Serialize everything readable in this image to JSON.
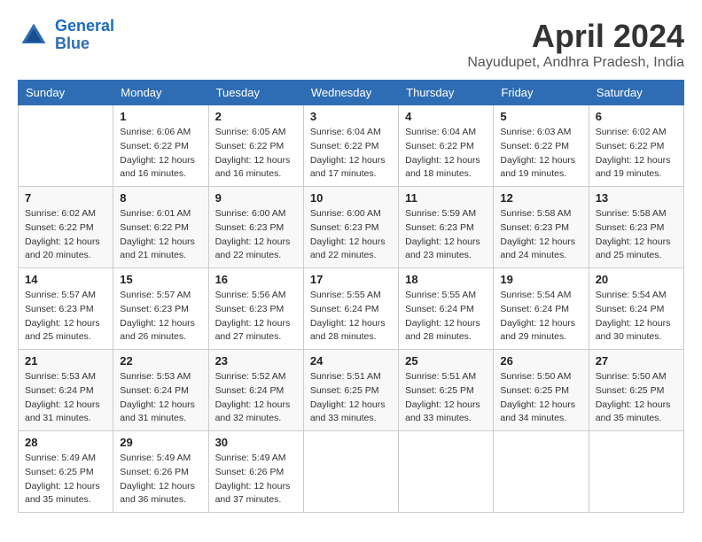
{
  "header": {
    "logo_line1": "General",
    "logo_line2": "Blue",
    "title": "April 2024",
    "location": "Nayudupet, Andhra Pradesh, India"
  },
  "columns": [
    "Sunday",
    "Monday",
    "Tuesday",
    "Wednesday",
    "Thursday",
    "Friday",
    "Saturday"
  ],
  "weeks": [
    [
      {
        "day": "",
        "info": ""
      },
      {
        "day": "1",
        "info": "Sunrise: 6:06 AM\nSunset: 6:22 PM\nDaylight: 12 hours\nand 16 minutes."
      },
      {
        "day": "2",
        "info": "Sunrise: 6:05 AM\nSunset: 6:22 PM\nDaylight: 12 hours\nand 16 minutes."
      },
      {
        "day": "3",
        "info": "Sunrise: 6:04 AM\nSunset: 6:22 PM\nDaylight: 12 hours\nand 17 minutes."
      },
      {
        "day": "4",
        "info": "Sunrise: 6:04 AM\nSunset: 6:22 PM\nDaylight: 12 hours\nand 18 minutes."
      },
      {
        "day": "5",
        "info": "Sunrise: 6:03 AM\nSunset: 6:22 PM\nDaylight: 12 hours\nand 19 minutes."
      },
      {
        "day": "6",
        "info": "Sunrise: 6:02 AM\nSunset: 6:22 PM\nDaylight: 12 hours\nand 19 minutes."
      }
    ],
    [
      {
        "day": "7",
        "info": "Sunrise: 6:02 AM\nSunset: 6:22 PM\nDaylight: 12 hours\nand 20 minutes."
      },
      {
        "day": "8",
        "info": "Sunrise: 6:01 AM\nSunset: 6:22 PM\nDaylight: 12 hours\nand 21 minutes."
      },
      {
        "day": "9",
        "info": "Sunrise: 6:00 AM\nSunset: 6:23 PM\nDaylight: 12 hours\nand 22 minutes."
      },
      {
        "day": "10",
        "info": "Sunrise: 6:00 AM\nSunset: 6:23 PM\nDaylight: 12 hours\nand 22 minutes."
      },
      {
        "day": "11",
        "info": "Sunrise: 5:59 AM\nSunset: 6:23 PM\nDaylight: 12 hours\nand 23 minutes."
      },
      {
        "day": "12",
        "info": "Sunrise: 5:58 AM\nSunset: 6:23 PM\nDaylight: 12 hours\nand 24 minutes."
      },
      {
        "day": "13",
        "info": "Sunrise: 5:58 AM\nSunset: 6:23 PM\nDaylight: 12 hours\nand 25 minutes."
      }
    ],
    [
      {
        "day": "14",
        "info": "Sunrise: 5:57 AM\nSunset: 6:23 PM\nDaylight: 12 hours\nand 25 minutes."
      },
      {
        "day": "15",
        "info": "Sunrise: 5:57 AM\nSunset: 6:23 PM\nDaylight: 12 hours\nand 26 minutes."
      },
      {
        "day": "16",
        "info": "Sunrise: 5:56 AM\nSunset: 6:23 PM\nDaylight: 12 hours\nand 27 minutes."
      },
      {
        "day": "17",
        "info": "Sunrise: 5:55 AM\nSunset: 6:24 PM\nDaylight: 12 hours\nand 28 minutes."
      },
      {
        "day": "18",
        "info": "Sunrise: 5:55 AM\nSunset: 6:24 PM\nDaylight: 12 hours\nand 28 minutes."
      },
      {
        "day": "19",
        "info": "Sunrise: 5:54 AM\nSunset: 6:24 PM\nDaylight: 12 hours\nand 29 minutes."
      },
      {
        "day": "20",
        "info": "Sunrise: 5:54 AM\nSunset: 6:24 PM\nDaylight: 12 hours\nand 30 minutes."
      }
    ],
    [
      {
        "day": "21",
        "info": "Sunrise: 5:53 AM\nSunset: 6:24 PM\nDaylight: 12 hours\nand 31 minutes."
      },
      {
        "day": "22",
        "info": "Sunrise: 5:53 AM\nSunset: 6:24 PM\nDaylight: 12 hours\nand 31 minutes."
      },
      {
        "day": "23",
        "info": "Sunrise: 5:52 AM\nSunset: 6:24 PM\nDaylight: 12 hours\nand 32 minutes."
      },
      {
        "day": "24",
        "info": "Sunrise: 5:51 AM\nSunset: 6:25 PM\nDaylight: 12 hours\nand 33 minutes."
      },
      {
        "day": "25",
        "info": "Sunrise: 5:51 AM\nSunset: 6:25 PM\nDaylight: 12 hours\nand 33 minutes."
      },
      {
        "day": "26",
        "info": "Sunrise: 5:50 AM\nSunset: 6:25 PM\nDaylight: 12 hours\nand 34 minutes."
      },
      {
        "day": "27",
        "info": "Sunrise: 5:50 AM\nSunset: 6:25 PM\nDaylight: 12 hours\nand 35 minutes."
      }
    ],
    [
      {
        "day": "28",
        "info": "Sunrise: 5:49 AM\nSunset: 6:25 PM\nDaylight: 12 hours\nand 35 minutes."
      },
      {
        "day": "29",
        "info": "Sunrise: 5:49 AM\nSunset: 6:26 PM\nDaylight: 12 hours\nand 36 minutes."
      },
      {
        "day": "30",
        "info": "Sunrise: 5:49 AM\nSunset: 6:26 PM\nDaylight: 12 hours\nand 37 minutes."
      },
      {
        "day": "",
        "info": ""
      },
      {
        "day": "",
        "info": ""
      },
      {
        "day": "",
        "info": ""
      },
      {
        "day": "",
        "info": ""
      }
    ]
  ]
}
